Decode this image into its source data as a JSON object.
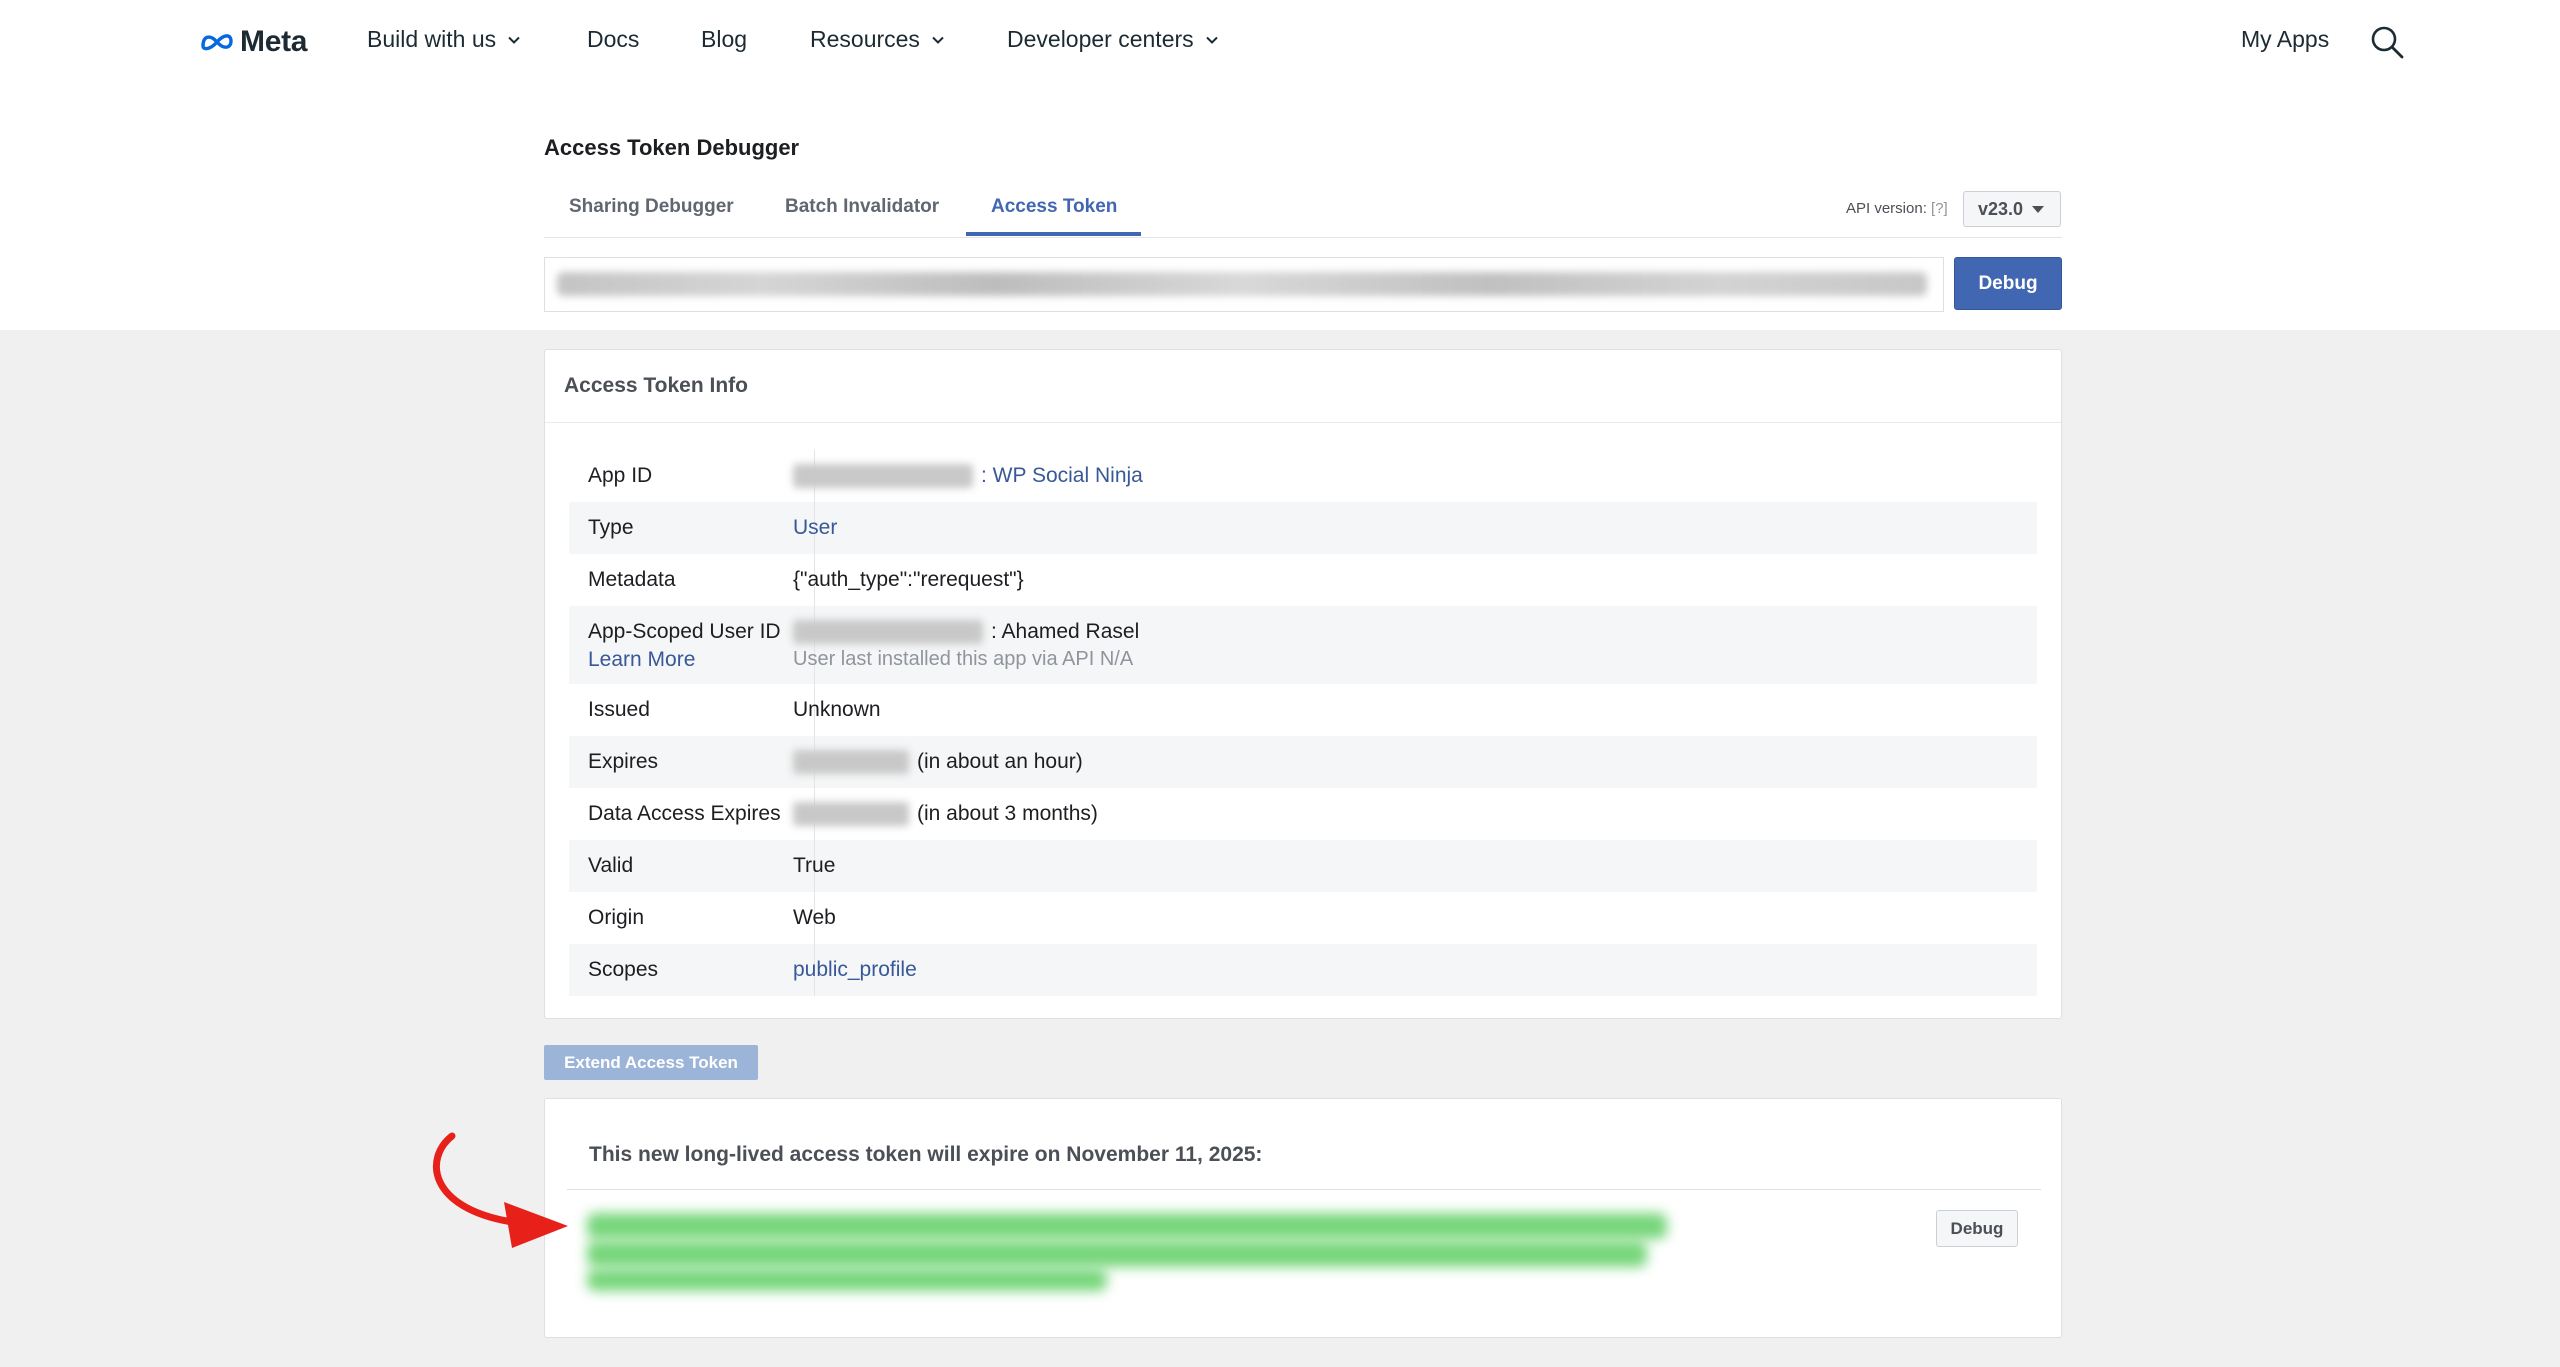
{
  "nav": {
    "logo_text": "Meta",
    "items": [
      {
        "label": "Build with us"
      },
      {
        "label": "Docs"
      },
      {
        "label": "Blog"
      },
      {
        "label": "Resources"
      },
      {
        "label": "Developer centers"
      }
    ],
    "my_apps": "My Apps"
  },
  "tool": {
    "title": "Access Token Debugger",
    "tabs": [
      {
        "label": "Sharing Debugger"
      },
      {
        "label": "Batch Invalidator"
      },
      {
        "label": "Access Token"
      }
    ],
    "active_tab": "Access Token",
    "api_label": "API version:",
    "api_help": "[?]",
    "api_version": "v23.0",
    "debug_label": "Debug"
  },
  "info": {
    "title": "Access Token Info",
    "rows": [
      {
        "label": "App ID",
        "value": ": WP Social Ninja"
      },
      {
        "label": "Type",
        "value": "User"
      },
      {
        "label": "Metadata",
        "value": "{\"auth_type\":\"rerequest\"}"
      },
      {
        "label": "App-Scoped User ID",
        "learn_more": "Learn More",
        "value": ": Ahamed Rasel",
        "sub": "User last installed this app via API N/A"
      },
      {
        "label": "Issued",
        "value": "Unknown"
      },
      {
        "label": "Expires",
        "value": "(in about an hour)"
      },
      {
        "label": "Data Access Expires",
        "value": "(in about 3 months)"
      },
      {
        "label": "Valid",
        "value": "True"
      },
      {
        "label": "Origin",
        "value": "Web"
      },
      {
        "label": "Scopes",
        "value": "public_profile"
      }
    ]
  },
  "extend": {
    "label": "Extend Access Token"
  },
  "new_token": {
    "message": "This new long-lived access token will expire on November 11, 2025:",
    "debug_label": "Debug"
  },
  "colors": {
    "accent": "#4267b2",
    "link": "#385898",
    "annotation_arrow": "#e8201a",
    "highlight_blur": "#5fcf64"
  },
  "icons": [
    "meta-logo-icon",
    "chevron-down-icon",
    "search-icon",
    "dropdown-triangle-icon",
    "red-curved-arrow-icon"
  ]
}
